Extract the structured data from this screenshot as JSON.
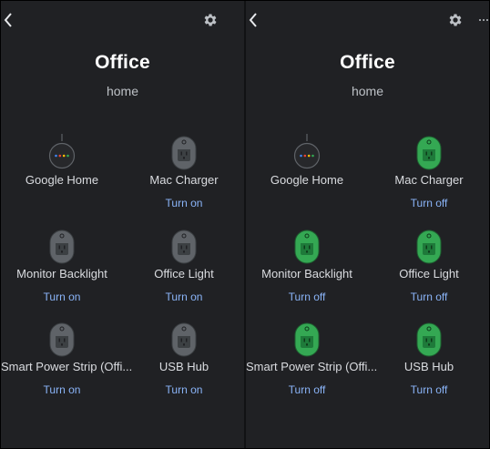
{
  "colors": {
    "background": "#202124",
    "text_primary": "#ffffff",
    "text_secondary": "#bdc1c6",
    "link": "#8ab4f8",
    "plug_off": "#5f6368",
    "plug_on": "#34a853"
  },
  "panels": [
    {
      "header": {
        "back_icon": "chevron-left-icon",
        "settings_icon": "gear-icon",
        "has_more": false
      },
      "room": {
        "title": "Office",
        "subtitle": "home"
      },
      "devices": [
        {
          "name": "Google Home",
          "icon": "google-home-icon",
          "state": "speaker",
          "action": ""
        },
        {
          "name": "Mac Charger",
          "icon": "smart-plug-icon",
          "state": "off",
          "action": "Turn on"
        },
        {
          "name": "Monitor Backlight",
          "icon": "smart-plug-icon",
          "state": "off",
          "action": "Turn on"
        },
        {
          "name": "Office Light",
          "icon": "smart-plug-icon",
          "state": "off",
          "action": "Turn on"
        },
        {
          "name": "Smart Power Strip (Offi...",
          "icon": "smart-plug-icon",
          "state": "off",
          "action": "Turn on"
        },
        {
          "name": "USB Hub",
          "icon": "smart-plug-icon",
          "state": "off",
          "action": "Turn on"
        }
      ]
    },
    {
      "header": {
        "back_icon": "chevron-left-icon",
        "settings_icon": "gear-icon",
        "has_more": true,
        "more_icon": "more-horizontal-icon"
      },
      "room": {
        "title": "Office",
        "subtitle": "home"
      },
      "devices": [
        {
          "name": "Google Home",
          "icon": "google-home-icon",
          "state": "speaker",
          "action": ""
        },
        {
          "name": "Mac Charger",
          "icon": "smart-plug-icon",
          "state": "on",
          "action": "Turn off"
        },
        {
          "name": "Monitor Backlight",
          "icon": "smart-plug-icon",
          "state": "on",
          "action": "Turn off"
        },
        {
          "name": "Office Light",
          "icon": "smart-plug-icon",
          "state": "on",
          "action": "Turn off"
        },
        {
          "name": "Smart Power Strip (Offi...",
          "icon": "smart-plug-icon",
          "state": "on",
          "action": "Turn off"
        },
        {
          "name": "USB Hub",
          "icon": "smart-plug-icon",
          "state": "on",
          "action": "Turn off"
        }
      ]
    }
  ]
}
